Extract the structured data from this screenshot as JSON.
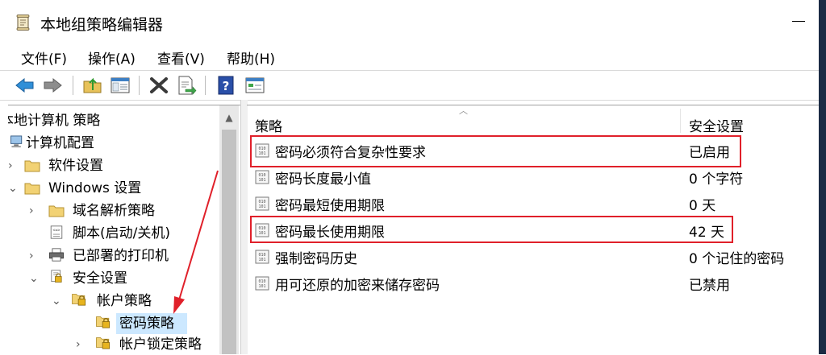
{
  "window": {
    "title": "本地组策略编辑器",
    "icon": "gpedit-scroll-icon"
  },
  "menu": {
    "items": [
      "文件(F)",
      "操作(A)",
      "查看(V)",
      "帮助(H)"
    ]
  },
  "toolbar": {
    "buttons": [
      "back-arrow-icon",
      "forward-arrow-icon",
      "up-folder-icon",
      "show-hide-tree-icon",
      "delete-icon",
      "export-list-icon",
      "help-icon",
      "properties-view-icon"
    ]
  },
  "tree": {
    "items": [
      {
        "label": "本地计算机 策略",
        "visible_label": "本地计算机 策略",
        "expanded": true
      },
      {
        "label": "计算机配置",
        "expanded": true
      },
      {
        "label": "软件设置",
        "expanded": false
      },
      {
        "label": "Windows 设置",
        "expanded": true
      },
      {
        "label": "域名解析策略",
        "expanded": false
      },
      {
        "label": "脚本(启动/关机)"
      },
      {
        "label": "已部署的打印机",
        "expanded": false
      },
      {
        "label": "安全设置",
        "expanded": true
      },
      {
        "label": "帐户策略",
        "expanded": true
      },
      {
        "label": "密码策略",
        "selected": true
      },
      {
        "label": "帐户锁定策略",
        "expanded": false
      }
    ]
  },
  "table": {
    "columns": [
      "策略",
      "安全设置"
    ],
    "rows": [
      {
        "name": "密码必须符合复杂性要求",
        "value": "已启用",
        "highlighted": true
      },
      {
        "name": "密码长度最小值",
        "value": "0 个字符"
      },
      {
        "name": "密码最短使用期限",
        "value": "0 天"
      },
      {
        "name": "密码最长使用期限",
        "value": "42 天",
        "highlighted": true
      },
      {
        "name": "强制密码历史",
        "value": "0 个记住的密码"
      },
      {
        "name": "用可还原的加密来储存密码",
        "value": "已禁用"
      }
    ]
  },
  "colors": {
    "annotation_red": "#e0202a",
    "selection_blue": "#cce8ff"
  }
}
